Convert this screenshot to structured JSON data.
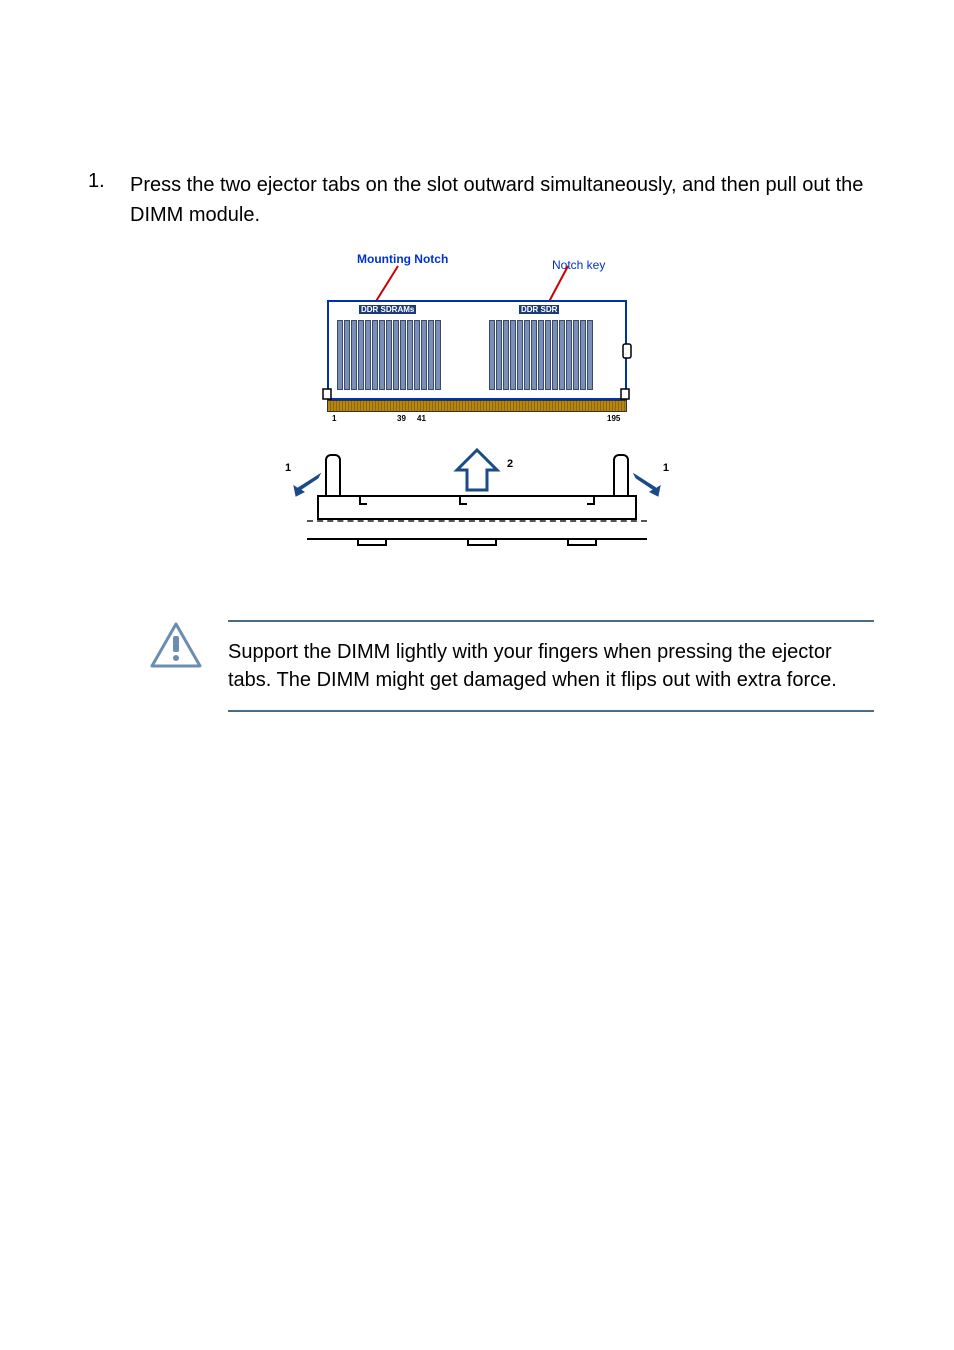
{
  "step": {
    "number": "1.",
    "text": "Press the two ejector tabs on the slot outward simultaneously, and then pull out the DIMM module."
  },
  "diagram": {
    "label_mounting": "Mounting Notch",
    "label_notchkey": "Notch key",
    "dimm_label_left": "DDR SDRAMs",
    "dimm_label_right": "DDR SDR",
    "marker_left": "1",
    "marker_center": "2",
    "marker_right": "1",
    "pin_labels": {
      "p1": "1",
      "p39": "39",
      "p41": "41",
      "p195": "195"
    }
  },
  "caution": {
    "text": "Support the DIMM lightly with your fingers when pressing the ejector tabs. The DIMM might get damaged when it flips out with extra force."
  }
}
